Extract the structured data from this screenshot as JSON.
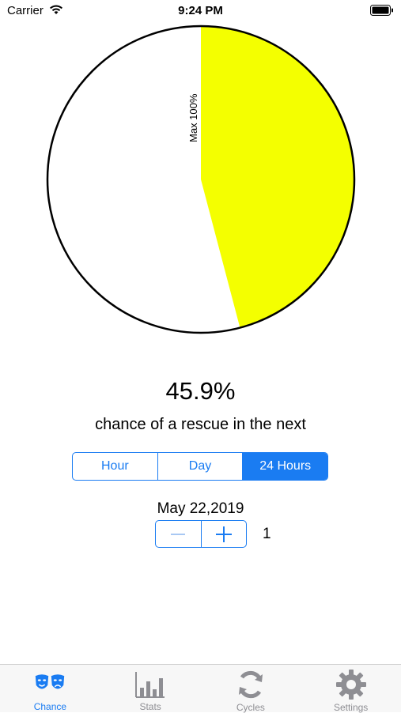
{
  "status_bar": {
    "carrier": "Carrier",
    "time": "9:24 PM"
  },
  "pie": {
    "value_percent": 45.9,
    "max_label": "Max 100%",
    "fill_color": "#f4ff00",
    "bg_color": "#ffffff",
    "border_color": "#000000"
  },
  "result": {
    "percent_text": "45.9%",
    "caption": "chance of a rescue in the next"
  },
  "segments": {
    "items": [
      "Hour",
      "Day",
      "24 Hours"
    ],
    "selected": "24 Hours"
  },
  "date": "May 22,2019",
  "stepper": {
    "value": "1"
  },
  "tab_bar": {
    "active": "Chance",
    "items": [
      {
        "label": "Chance",
        "icon": "theater-masks-icon"
      },
      {
        "label": "Stats",
        "icon": "bar-chart-icon"
      },
      {
        "label": "Cycles",
        "icon": "refresh-cycle-icon"
      },
      {
        "label": "Settings",
        "icon": "gear-icon"
      }
    ]
  },
  "colors": {
    "accent": "#1a7cf2",
    "tab_inactive": "#8e8e93"
  }
}
